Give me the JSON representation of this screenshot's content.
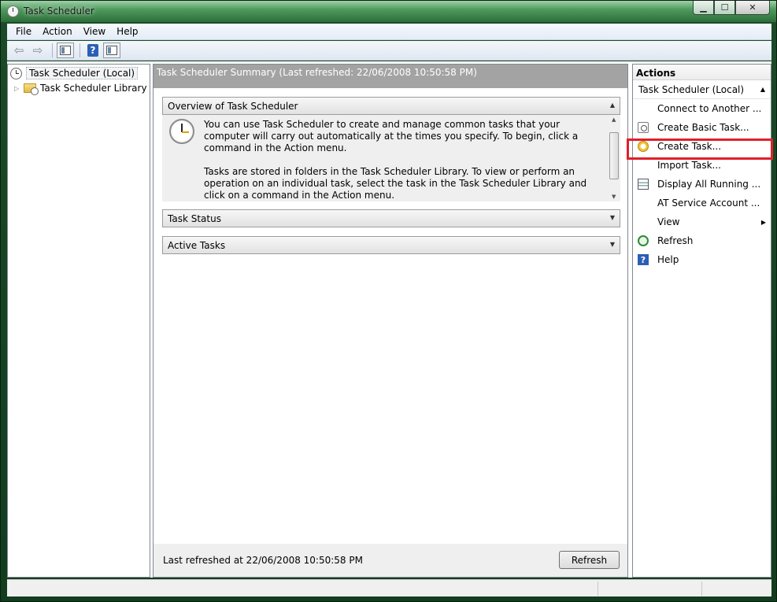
{
  "window": {
    "title": "Task Scheduler"
  },
  "menu": [
    "File",
    "Action",
    "View",
    "Help"
  ],
  "tree": {
    "root": "Task Scheduler (Local)",
    "child": "Task Scheduler Library"
  },
  "center": {
    "summary_title": "Task Scheduler Summary (Last refreshed: 22/06/2008 10:50:58 PM)",
    "overview_title": "Overview of Task Scheduler",
    "overview_p1": "You can use Task Scheduler to create and manage common tasks that your computer will carry out automatically at the times you specify. To begin, click a command in the Action menu.",
    "overview_p2": "Tasks are stored in folders in the Task Scheduler Library. To view or perform an operation on an individual task, select the task in the Task Scheduler Library and click on a command in the Action menu.",
    "task_status": "Task Status",
    "active_tasks": "Active Tasks",
    "footer_text": "Last refreshed at 22/06/2008 10:50:58 PM",
    "refresh_button": "Refresh"
  },
  "actions": {
    "title": "Actions",
    "group": "Task Scheduler (Local)",
    "items": [
      {
        "label": "Connect to Another ...",
        "icon": "none"
      },
      {
        "label": "Create Basic Task...",
        "icon": "clock-document"
      },
      {
        "label": "Create Task...",
        "icon": "task"
      },
      {
        "label": "Import Task...",
        "icon": "none"
      },
      {
        "label": "Display All Running ...",
        "icon": "list"
      },
      {
        "label": "AT Service Account ...",
        "icon": "none"
      },
      {
        "label": "View",
        "icon": "none"
      },
      {
        "label": "Refresh",
        "icon": "refresh"
      },
      {
        "label": "Help",
        "icon": "help"
      }
    ]
  },
  "colors": {
    "highlight": "#e0202a",
    "summary_header": "#a3a3a3"
  }
}
